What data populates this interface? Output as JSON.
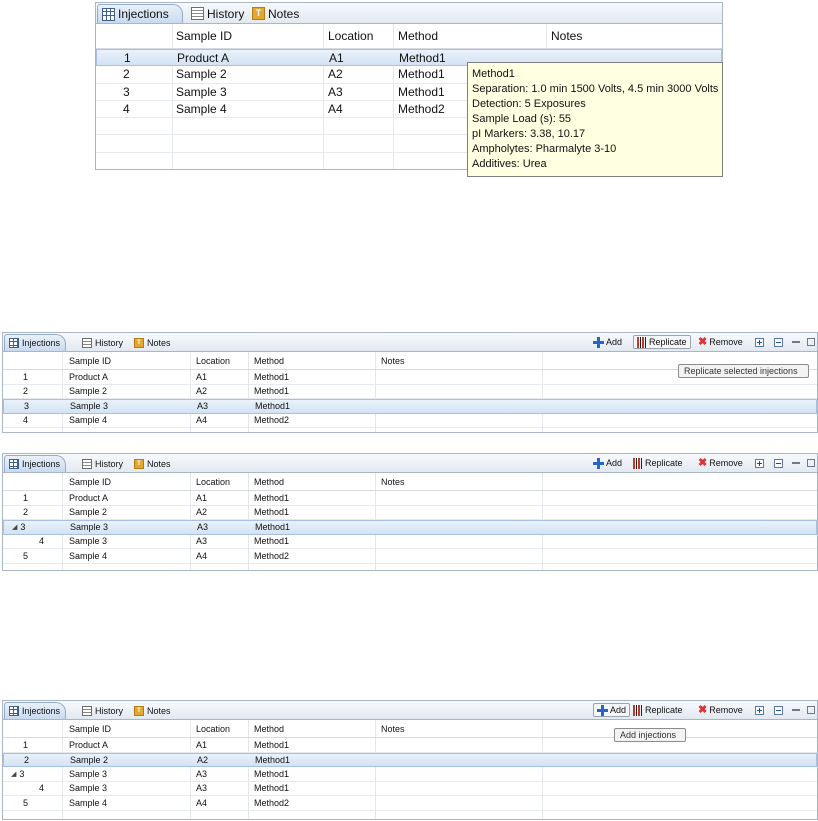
{
  "colors": {
    "selected_row": "#d3e2f4",
    "tooltip_bg": "#ffffe1",
    "accent": "#2565c7"
  },
  "tabs": [
    {
      "label": "Injections",
      "icon": "grid-table-icon"
    },
    {
      "label": "History",
      "icon": "history-icon"
    },
    {
      "label": "Notes",
      "icon": "notes-icon"
    }
  ],
  "toolbar": {
    "add": "Add",
    "replicate": "Replicate",
    "remove": "Remove"
  },
  "columns": [
    "Sample ID",
    "Location",
    "Method",
    "Notes"
  ],
  "panel1": {
    "rows": [
      {
        "num": "1",
        "sample": "Product A",
        "location": "A1",
        "method": "Method1",
        "selected": true
      },
      {
        "num": "2",
        "sample": "Sample 2",
        "location": "A2",
        "method": "Method1"
      },
      {
        "num": "3",
        "sample": "Sample 3",
        "location": "A3",
        "method": "Method1"
      },
      {
        "num": "4",
        "sample": "Sample 4",
        "location": "A4",
        "method": "Method2"
      }
    ],
    "tooltip": [
      "Method1",
      "Separation: 1.0 min 1500 Volts, 4.5 min 3000 Volts",
      "Detection: 5 Exposures",
      "Sample Load (s): 55",
      "pI Markers: 3.38, 10.17",
      "Ampholytes: Pharmalyte 3-10",
      "Additives: Urea"
    ]
  },
  "panel2": {
    "tooltip": "Replicate selected injections",
    "rows": [
      {
        "num": "1",
        "sample": "Product A",
        "location": "A1",
        "method": "Method1"
      },
      {
        "num": "2",
        "sample": "Sample 2",
        "location": "A2",
        "method": "Method1"
      },
      {
        "num": "3",
        "sample": "Sample 3",
        "location": "A3",
        "method": "Method1",
        "selected": true
      },
      {
        "num": "4",
        "sample": "Sample 4",
        "location": "A4",
        "method": "Method2"
      }
    ]
  },
  "panel3": {
    "rows": [
      {
        "num": "1",
        "sample": "Product A",
        "location": "A1",
        "method": "Method1"
      },
      {
        "num": "2",
        "sample": "Sample 2",
        "location": "A2",
        "method": "Method1"
      },
      {
        "num": "3",
        "sample": "Sample 3",
        "location": "A3",
        "method": "Method1",
        "selected": true,
        "expanded": true
      },
      {
        "num": "4",
        "sample": "Sample 3",
        "location": "A3",
        "method": "Method1",
        "child": true
      },
      {
        "num": "5",
        "sample": "Sample 4",
        "location": "A4",
        "method": "Method2"
      }
    ]
  },
  "panel4": {
    "tooltip": "Add injections",
    "rows": [
      {
        "num": "1",
        "sample": "Product A",
        "location": "A1",
        "method": "Method1"
      },
      {
        "num": "2",
        "sample": "Sample 2",
        "location": "A2",
        "method": "Method1",
        "selected": true
      },
      {
        "num": "3",
        "sample": "Sample 3",
        "location": "A3",
        "method": "Method1",
        "expanded": true
      },
      {
        "num": "4",
        "sample": "Sample 3",
        "location": "A3",
        "method": "Method1",
        "child": true
      },
      {
        "num": "5",
        "sample": "Sample 4",
        "location": "A4",
        "method": "Method2"
      }
    ]
  }
}
